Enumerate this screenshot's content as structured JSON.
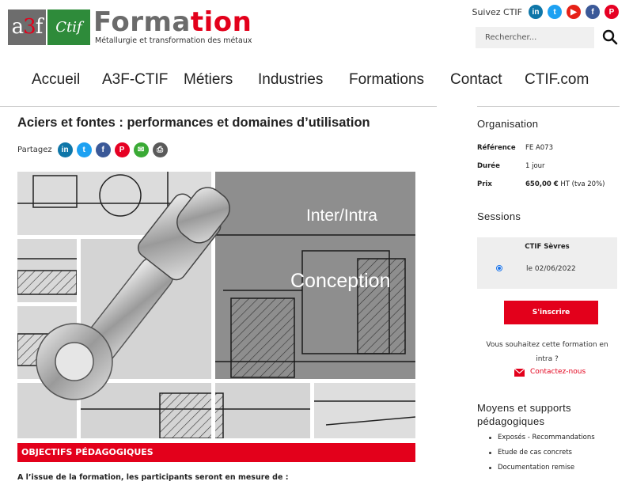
{
  "logo": {
    "a3f_left": "a",
    "a3f_mid": "3",
    "a3f_right": "f",
    "ctif": "Ctif",
    "formation_gray": "Forma",
    "formation_red": "tion",
    "tagline": "Métallurgie et transformation des métaux"
  },
  "header": {
    "follow_label": "Suivez CTIF",
    "social": [
      {
        "icon": "linkedin-icon",
        "glyph": "in"
      },
      {
        "icon": "twitter-icon",
        "glyph": "t"
      },
      {
        "icon": "youtube-icon",
        "glyph": "▶"
      },
      {
        "icon": "facebook-icon",
        "glyph": "f"
      },
      {
        "icon": "pinterest-icon",
        "glyph": "P"
      }
    ],
    "search_placeholder": "Rechercher..."
  },
  "nav": {
    "items": [
      "Accueil",
      "A3F-CTIF",
      "Métiers",
      "Industries",
      "Formations",
      "Contact",
      "CTIF.com"
    ]
  },
  "main": {
    "title": "Aciers et fontes : performances et domaines d’utilisation",
    "share_label": "Partagez",
    "share_icons": [
      {
        "icon": "linkedin-icon",
        "glyph": "in"
      },
      {
        "icon": "twitter-icon",
        "glyph": "t"
      },
      {
        "icon": "facebook-icon",
        "glyph": "f"
      },
      {
        "icon": "pinterest-icon",
        "glyph": "P"
      },
      {
        "icon": "mail-icon",
        "glyph": "✉"
      },
      {
        "icon": "print-icon",
        "glyph": "⎙"
      }
    ],
    "hero_text_1": "Inter/Intra",
    "hero_text_2": "Conception",
    "objectives_heading": "OBJECTIFS PÉDAGOGIQUES",
    "intro_text": "A l’issue de la formation, les participants seront en mesure de :"
  },
  "sidebar": {
    "organisation_heading": "Organisation",
    "rows": [
      {
        "key": "Référence",
        "value": "FE A073"
      },
      {
        "key": "Durée",
        "value": "1 jour"
      },
      {
        "key": "Prix",
        "value_bold": "650,00 €",
        "value_rest": " HT (tva 20%)"
      }
    ],
    "sessions_heading": "Sessions",
    "session_location": "CTIF Sèvres",
    "session_date": "le 02/06/2022",
    "register_label": "S'inscrire",
    "intra_question_1": "Vous souhaitez cette formation en",
    "intra_question_2": "intra ?",
    "contact_label": "Contactez-nous",
    "means_heading_1": "Moyens et supports",
    "means_heading_2": "pédagogiques",
    "means_items": [
      "Exposés - Recommandations",
      "Etude de cas concrets",
      "Documentation remise"
    ]
  },
  "colors": {
    "accent_red": "#e3001b",
    "ctif_green": "#2e8b3a",
    "logo_gray": "#6b6b6b"
  }
}
